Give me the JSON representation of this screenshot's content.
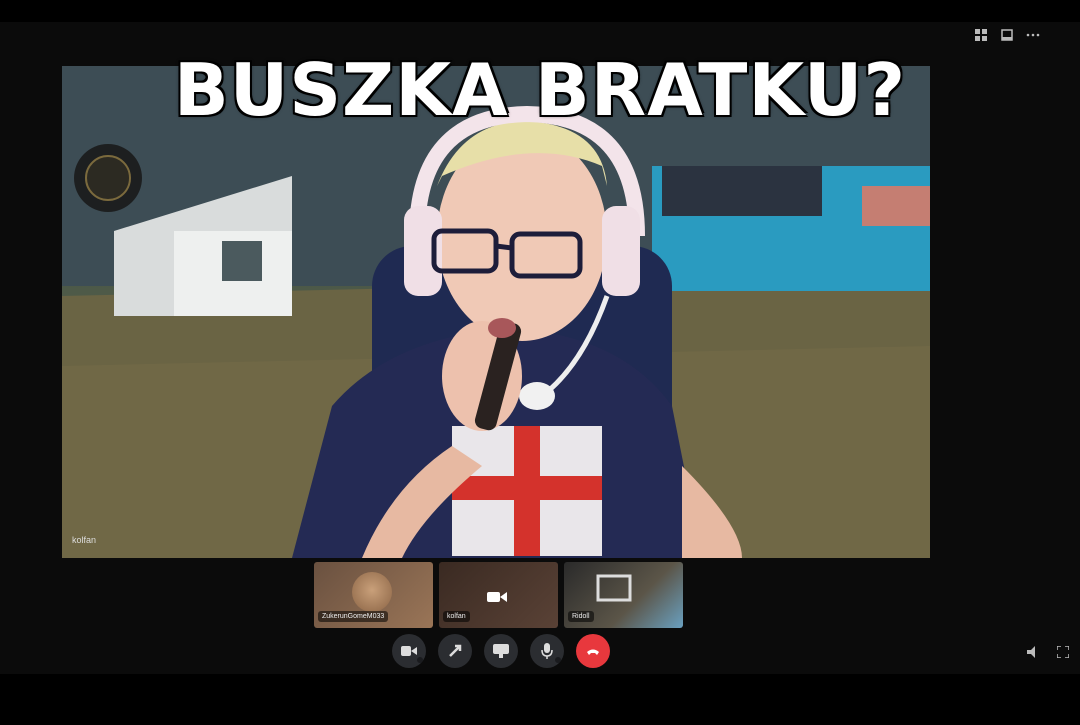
{
  "caption": {
    "text": "BUSZKA BRATKU?"
  },
  "main_video": {
    "participant_name": "kolfan"
  },
  "participants": [
    {
      "name": "ZukerunGomeM033"
    },
    {
      "name": "kolfan"
    },
    {
      "name": "Ridoll"
    }
  ],
  "top_controls": [
    "grid-icon",
    "popout-icon",
    "more-icon"
  ],
  "call_controls": [
    "camera-icon",
    "screen-share-icon",
    "activity-icon",
    "microphone-icon",
    "end-call-icon"
  ],
  "colors": {
    "end_call": "#e8383d",
    "control_bg": "#2b2d31"
  }
}
